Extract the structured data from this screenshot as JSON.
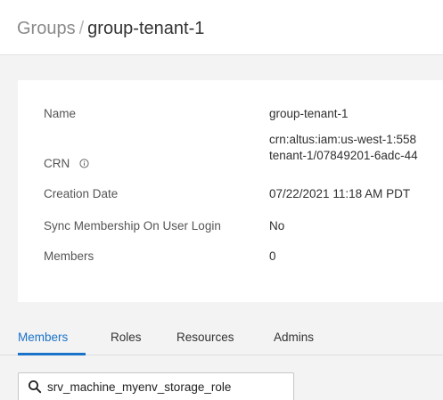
{
  "breadcrumb": {
    "root": "Groups",
    "separator": "/",
    "current": "group-tenant-1"
  },
  "details": {
    "name_label": "Name",
    "name_value": "group-tenant-1",
    "crn_label": "CRN",
    "crn_value_line1": "crn:altus:iam:us-west-1:558",
    "crn_value_line2": "tenant-1/07849201-6adc-44",
    "creation_date_label": "Creation Date",
    "creation_date_value": "07/22/2021 11:18 AM PDT",
    "sync_label": "Sync Membership On User Login",
    "sync_value": "No",
    "members_label": "Members",
    "members_value": "0"
  },
  "tabs": [
    {
      "label": "Members",
      "active": true
    },
    {
      "label": "Roles",
      "active": false
    },
    {
      "label": "Resources",
      "active": false
    },
    {
      "label": "Admins",
      "active": false
    }
  ],
  "search": {
    "value": "srv_machine_myenv_storage_role",
    "icon": "search-icon"
  },
  "colors": {
    "accent": "#1a73c8",
    "background": "#f3f3f3",
    "card": "#ffffff"
  }
}
